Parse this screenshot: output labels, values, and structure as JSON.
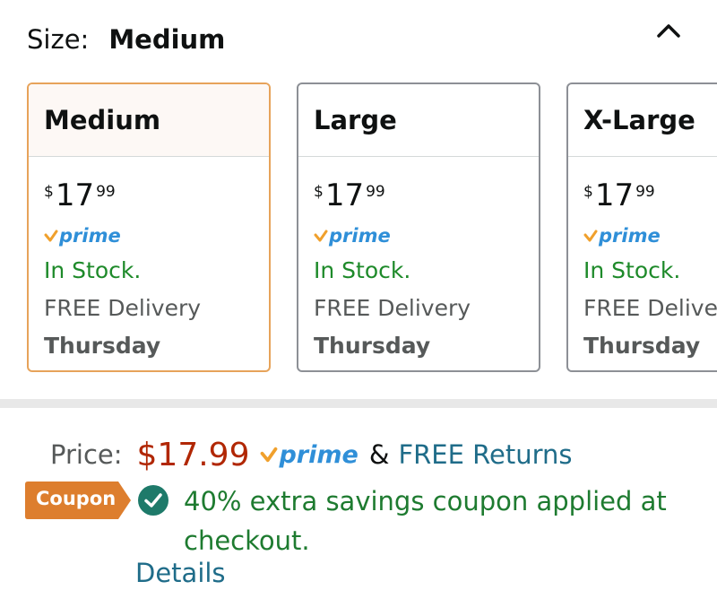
{
  "size_selector": {
    "label": "Size:",
    "selected_value": "Medium",
    "collapse_icon": "chevron-up-icon"
  },
  "size_options": [
    {
      "name": "Medium",
      "price_symbol": "$",
      "price_whole": "17",
      "price_fraction": "99",
      "prime": "prime",
      "stock": "In Stock.",
      "delivery": "FREE Delivery",
      "day": "Thursday",
      "selected": true
    },
    {
      "name": "Large",
      "price_symbol": "$",
      "price_whole": "17",
      "price_fraction": "99",
      "prime": "prime",
      "stock": "In Stock.",
      "delivery": "FREE Delivery",
      "day": "Thursday",
      "selected": false
    },
    {
      "name": "X-Large",
      "price_symbol": "$",
      "price_whole": "17",
      "price_fraction": "99",
      "prime": "prime",
      "stock": "In Stock.",
      "delivery": "FREE Delivery",
      "day": "Thursday",
      "selected": false
    }
  ],
  "price_section": {
    "label": "Price:",
    "amount": "$17.99",
    "prime": "prime",
    "ampersand": "&",
    "returns_link": "FREE Returns"
  },
  "coupon": {
    "tag": "Coupon",
    "message": "40% extra savings coupon applied at checkout.",
    "details_link": "Details"
  },
  "colors": {
    "selected_border": "#e7a35a",
    "price_red": "#b12704",
    "link_teal": "#1f6c89",
    "stock_green": "#1e8a2a",
    "prime_blue": "#2f8fd8",
    "prime_check_orange": "#f0a02c",
    "coupon_orange": "#dd7e2e"
  }
}
